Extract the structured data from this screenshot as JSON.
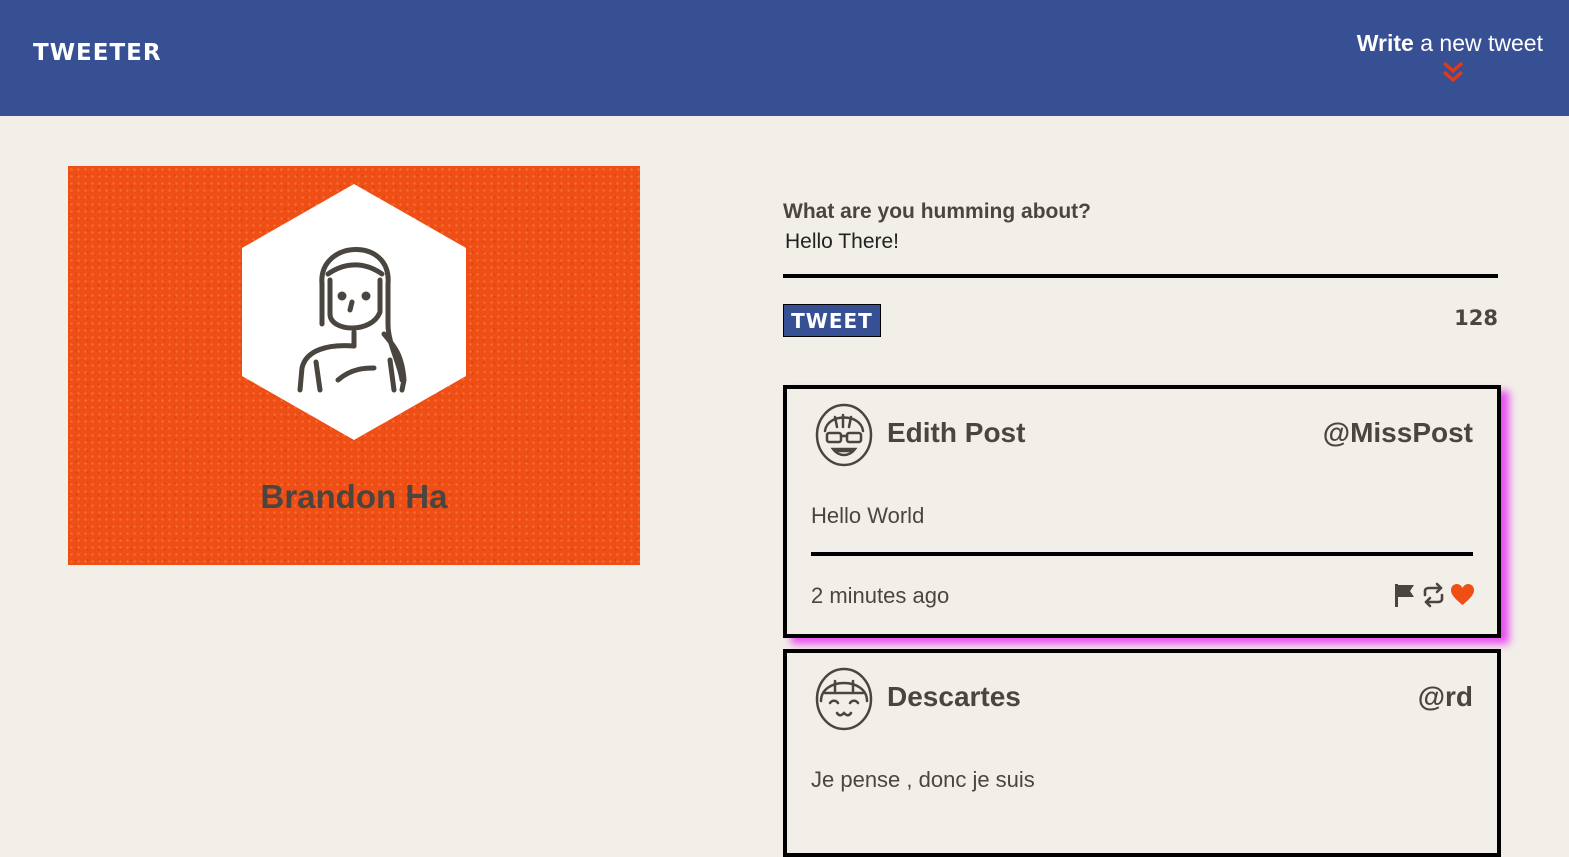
{
  "navbar": {
    "brand": "TWEETER",
    "compose_strong": "Write",
    "compose_rest": " a new tweet",
    "accent_color": "#e03a1a"
  },
  "profile": {
    "name": "Brandon Ha",
    "background_color": "#ef4e15"
  },
  "compose_form": {
    "label": "What are you humming about?",
    "value": "Hello There!",
    "button_label": "TWEET",
    "char_count": "128"
  },
  "tweets": [
    {
      "author": "Edith Post",
      "handle": "@MissPost",
      "content": "Hello World",
      "time": "2 minutes ago",
      "actions": [
        "flag-icon",
        "retweet-icon",
        "heart-icon"
      ]
    },
    {
      "author": "Descartes",
      "handle": "@rd",
      "content": "Je pense , donc je suis"
    }
  ],
  "colors": {
    "header": "#374f93",
    "page": "#f2efe9",
    "text": "#4a453f",
    "like": "#ef4e15",
    "hover_shadow": "#e84cf0"
  }
}
